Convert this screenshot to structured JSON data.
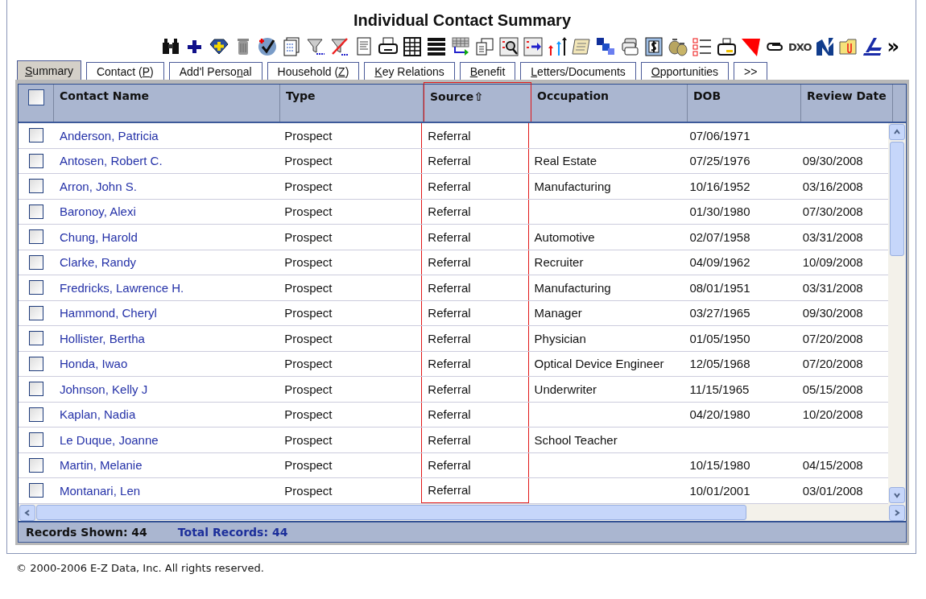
{
  "window": {
    "title": "Individual Contact Summary"
  },
  "toolbar": {
    "text_label": "DXO",
    "more": "»"
  },
  "tabs": [
    {
      "key": "S",
      "after": "ummary",
      "selected": true
    },
    {
      "before": "Contact (",
      "key": "P",
      "after": ")",
      "selected": false
    },
    {
      "before": "Add'l Perso",
      "key": "n",
      "after": "al",
      "selected": false
    },
    {
      "before": "Household (",
      "key": "Z",
      "after": ")",
      "selected": false
    },
    {
      "key": "K",
      "after": "ey Relations",
      "selected": false
    },
    {
      "key": "B",
      "after": "enefit",
      "selected": false
    },
    {
      "key": "L",
      "after": "etters/Documents",
      "selected": false
    },
    {
      "key": "O",
      "after": "pportunities",
      "selected": false
    },
    {
      "before": ">>",
      "selected": false
    }
  ],
  "table": {
    "select_all": {
      "checked": false
    },
    "columns": [
      {
        "label": "Contact Name",
        "highlighted": false
      },
      {
        "label": "Type",
        "highlighted": false
      },
      {
        "label": "Source",
        "sort_mark": "⇧",
        "highlighted": true
      },
      {
        "label": "Occupation",
        "highlighted": false
      },
      {
        "label": "DOB",
        "highlighted": false
      },
      {
        "label": "Review Date",
        "highlighted": false
      }
    ],
    "rows": [
      {
        "checked": false,
        "cells": [
          "Anderson, Patricia",
          "Prospect",
          "Referral",
          "",
          "07/06/1971",
          ""
        ]
      },
      {
        "checked": false,
        "cells": [
          "Antosen, Robert C.",
          "Prospect",
          "Referral",
          "Real Estate",
          "07/25/1976",
          "09/30/2008"
        ]
      },
      {
        "checked": false,
        "cells": [
          "Arron, John S.",
          "Prospect",
          "Referral",
          "Manufacturing",
          "10/16/1952",
          "03/16/2008"
        ]
      },
      {
        "checked": false,
        "cells": [
          "Baronoy, Alexi",
          "Prospect",
          "Referral",
          "",
          "01/30/1980",
          "07/30/2008"
        ]
      },
      {
        "checked": false,
        "cells": [
          "Chung, Harold",
          "Prospect",
          "Referral",
          "Automotive",
          "02/07/1958",
          "03/31/2008"
        ]
      },
      {
        "checked": false,
        "cells": [
          "Clarke, Randy",
          "Prospect",
          "Referral",
          "Recruiter",
          "04/09/1962",
          "10/09/2008"
        ]
      },
      {
        "checked": false,
        "cells": [
          "Fredricks, Lawrence H.",
          "Prospect",
          "Referral",
          "Manufacturing",
          "08/01/1951",
          "03/31/2008"
        ]
      },
      {
        "checked": false,
        "cells": [
          "Hammond, Cheryl",
          "Prospect",
          "Referral",
          "Manager",
          "03/27/1965",
          "09/30/2008"
        ]
      },
      {
        "checked": false,
        "cells": [
          "Hollister, Bertha",
          "Prospect",
          "Referral",
          "Physician",
          "01/05/1950",
          "07/20/2008"
        ]
      },
      {
        "checked": false,
        "cells": [
          "Honda, Iwao",
          "Prospect",
          "Referral",
          "Optical Device Engineer",
          "12/05/1968",
          "07/20/2008"
        ]
      },
      {
        "checked": false,
        "cells": [
          "Johnson, Kelly J",
          "Prospect",
          "Referral",
          "Underwriter",
          "11/15/1965",
          "05/15/2008"
        ]
      },
      {
        "checked": false,
        "cells": [
          "Kaplan, Nadia",
          "Prospect",
          "Referral",
          "",
          "04/20/1980",
          "10/20/2008"
        ]
      },
      {
        "checked": false,
        "cells": [
          "Le Duque, Joanne",
          "Prospect",
          "Referral",
          "School Teacher",
          "",
          ""
        ]
      },
      {
        "checked": false,
        "cells": [
          "Martin, Melanie",
          "Prospect",
          "Referral",
          "",
          "10/15/1980",
          "04/15/2008"
        ]
      },
      {
        "checked": false,
        "cells": [
          "Montanari, Len",
          "Prospect",
          "Referral",
          "",
          "10/01/2001",
          "03/01/2008"
        ]
      }
    ]
  },
  "status_bar": {
    "records_shown": "Records Shown: 44",
    "total_records": "Total Records: 44"
  },
  "footer": {
    "copyright": "© 2000-2006 E-Z Data, Inc. All rights reserved."
  }
}
